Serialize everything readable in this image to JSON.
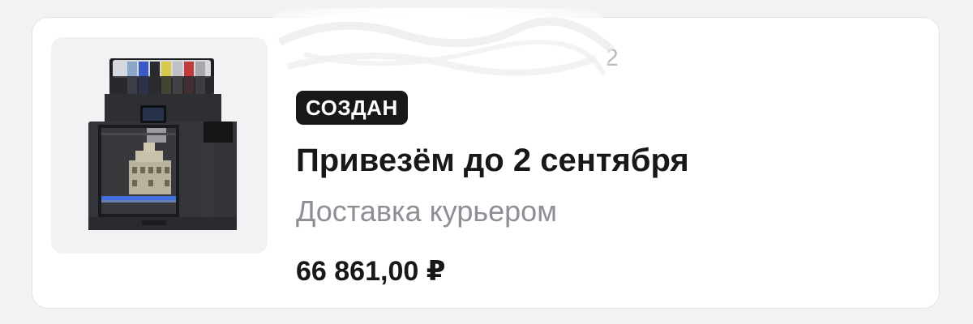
{
  "order": {
    "number_visible_fragment": "2",
    "status": "СОЗДАН",
    "delivery_title": "Привезём до 2 сентября",
    "delivery_method": "Доставка курьером",
    "price": "66 861,00 ₽"
  },
  "product_image": {
    "icon": "3d-printer-product-image"
  },
  "colors": {
    "page_background": "#f2f2f4",
    "card_background": "#ffffff",
    "badge_background": "#18181b",
    "badge_text": "#ffffff",
    "title_text": "#18181b",
    "secondary_text": "#8e8e96"
  }
}
